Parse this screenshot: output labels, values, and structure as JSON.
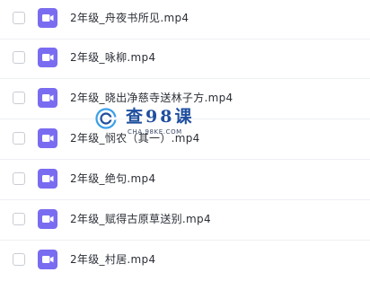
{
  "files": [
    {
      "name": "2年级_舟夜书所见.mp4",
      "icon": "video-file-icon"
    },
    {
      "name": "2年级_咏柳.mp4",
      "icon": "video-file-icon"
    },
    {
      "name": "2年级_晓出净慈寺送林子方.mp4",
      "icon": "video-file-icon"
    },
    {
      "name": "2年级_悯农（其一）.mp4",
      "icon": "video-file-icon"
    },
    {
      "name": "2年级_绝句.mp4",
      "icon": "video-file-icon"
    },
    {
      "name": "2年级_赋得古原草送别.mp4",
      "icon": "video-file-icon"
    },
    {
      "name": "2年级_村居.mp4",
      "icon": "video-file-icon"
    }
  ],
  "watermark": {
    "title": "查98课",
    "domain": "CHA.98KE.COM"
  },
  "colors": {
    "file_icon": "#7a6cf0",
    "watermark_blue": "#1f4f9e",
    "watermark_accent": "#3aa0e8"
  }
}
